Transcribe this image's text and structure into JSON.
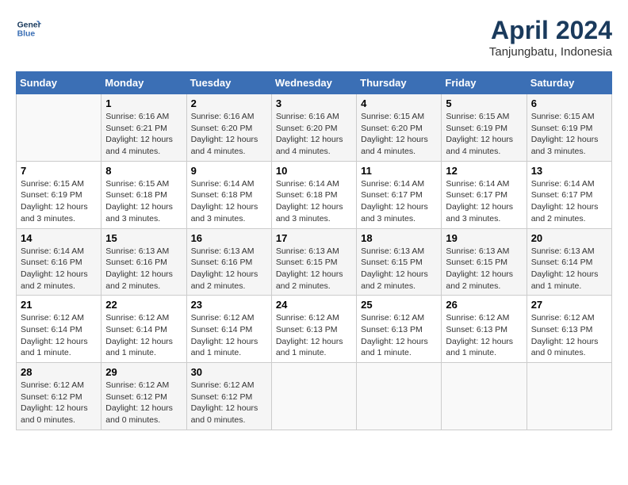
{
  "header": {
    "logo_line1": "General",
    "logo_line2": "Blue",
    "month_year": "April 2024",
    "location": "Tanjungbatu, Indonesia"
  },
  "days_of_week": [
    "Sunday",
    "Monday",
    "Tuesday",
    "Wednesday",
    "Thursday",
    "Friday",
    "Saturday"
  ],
  "weeks": [
    [
      {
        "day": "",
        "info": ""
      },
      {
        "day": "1",
        "info": "Sunrise: 6:16 AM\nSunset: 6:21 PM\nDaylight: 12 hours\nand 4 minutes."
      },
      {
        "day": "2",
        "info": "Sunrise: 6:16 AM\nSunset: 6:20 PM\nDaylight: 12 hours\nand 4 minutes."
      },
      {
        "day": "3",
        "info": "Sunrise: 6:16 AM\nSunset: 6:20 PM\nDaylight: 12 hours\nand 4 minutes."
      },
      {
        "day": "4",
        "info": "Sunrise: 6:15 AM\nSunset: 6:20 PM\nDaylight: 12 hours\nand 4 minutes."
      },
      {
        "day": "5",
        "info": "Sunrise: 6:15 AM\nSunset: 6:19 PM\nDaylight: 12 hours\nand 4 minutes."
      },
      {
        "day": "6",
        "info": "Sunrise: 6:15 AM\nSunset: 6:19 PM\nDaylight: 12 hours\nand 3 minutes."
      }
    ],
    [
      {
        "day": "7",
        "info": "Sunrise: 6:15 AM\nSunset: 6:19 PM\nDaylight: 12 hours\nand 3 minutes."
      },
      {
        "day": "8",
        "info": "Sunrise: 6:15 AM\nSunset: 6:18 PM\nDaylight: 12 hours\nand 3 minutes."
      },
      {
        "day": "9",
        "info": "Sunrise: 6:14 AM\nSunset: 6:18 PM\nDaylight: 12 hours\nand 3 minutes."
      },
      {
        "day": "10",
        "info": "Sunrise: 6:14 AM\nSunset: 6:18 PM\nDaylight: 12 hours\nand 3 minutes."
      },
      {
        "day": "11",
        "info": "Sunrise: 6:14 AM\nSunset: 6:17 PM\nDaylight: 12 hours\nand 3 minutes."
      },
      {
        "day": "12",
        "info": "Sunrise: 6:14 AM\nSunset: 6:17 PM\nDaylight: 12 hours\nand 3 minutes."
      },
      {
        "day": "13",
        "info": "Sunrise: 6:14 AM\nSunset: 6:17 PM\nDaylight: 12 hours\nand 2 minutes."
      }
    ],
    [
      {
        "day": "14",
        "info": "Sunrise: 6:14 AM\nSunset: 6:16 PM\nDaylight: 12 hours\nand 2 minutes."
      },
      {
        "day": "15",
        "info": "Sunrise: 6:13 AM\nSunset: 6:16 PM\nDaylight: 12 hours\nand 2 minutes."
      },
      {
        "day": "16",
        "info": "Sunrise: 6:13 AM\nSunset: 6:16 PM\nDaylight: 12 hours\nand 2 minutes."
      },
      {
        "day": "17",
        "info": "Sunrise: 6:13 AM\nSunset: 6:15 PM\nDaylight: 12 hours\nand 2 minutes."
      },
      {
        "day": "18",
        "info": "Sunrise: 6:13 AM\nSunset: 6:15 PM\nDaylight: 12 hours\nand 2 minutes."
      },
      {
        "day": "19",
        "info": "Sunrise: 6:13 AM\nSunset: 6:15 PM\nDaylight: 12 hours\nand 2 minutes."
      },
      {
        "day": "20",
        "info": "Sunrise: 6:13 AM\nSunset: 6:14 PM\nDaylight: 12 hours\nand 1 minute."
      }
    ],
    [
      {
        "day": "21",
        "info": "Sunrise: 6:12 AM\nSunset: 6:14 PM\nDaylight: 12 hours\nand 1 minute."
      },
      {
        "day": "22",
        "info": "Sunrise: 6:12 AM\nSunset: 6:14 PM\nDaylight: 12 hours\nand 1 minute."
      },
      {
        "day": "23",
        "info": "Sunrise: 6:12 AM\nSunset: 6:14 PM\nDaylight: 12 hours\nand 1 minute."
      },
      {
        "day": "24",
        "info": "Sunrise: 6:12 AM\nSunset: 6:13 PM\nDaylight: 12 hours\nand 1 minute."
      },
      {
        "day": "25",
        "info": "Sunrise: 6:12 AM\nSunset: 6:13 PM\nDaylight: 12 hours\nand 1 minute."
      },
      {
        "day": "26",
        "info": "Sunrise: 6:12 AM\nSunset: 6:13 PM\nDaylight: 12 hours\nand 1 minute."
      },
      {
        "day": "27",
        "info": "Sunrise: 6:12 AM\nSunset: 6:13 PM\nDaylight: 12 hours\nand 0 minutes."
      }
    ],
    [
      {
        "day": "28",
        "info": "Sunrise: 6:12 AM\nSunset: 6:12 PM\nDaylight: 12 hours\nand 0 minutes."
      },
      {
        "day": "29",
        "info": "Sunrise: 6:12 AM\nSunset: 6:12 PM\nDaylight: 12 hours\nand 0 minutes."
      },
      {
        "day": "30",
        "info": "Sunrise: 6:12 AM\nSunset: 6:12 PM\nDaylight: 12 hours\nand 0 minutes."
      },
      {
        "day": "",
        "info": ""
      },
      {
        "day": "",
        "info": ""
      },
      {
        "day": "",
        "info": ""
      },
      {
        "day": "",
        "info": ""
      }
    ]
  ]
}
